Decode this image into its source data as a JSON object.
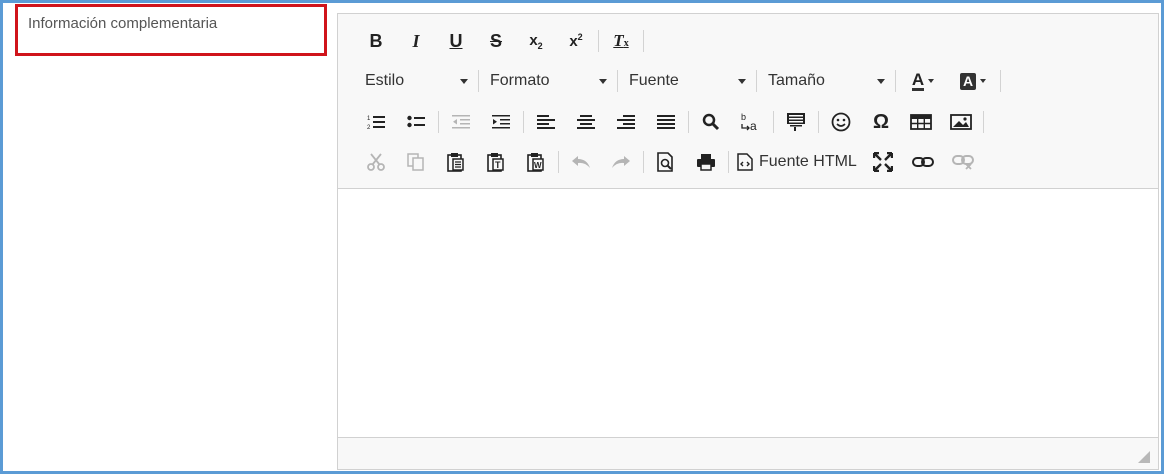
{
  "field": {
    "label": "Información complementaria"
  },
  "toolbar": {
    "row1": [
      {
        "name": "bold-button",
        "glyph": "B",
        "cls": "bold-b"
      },
      {
        "name": "italic-button",
        "glyph": "I",
        "cls": "ital-i"
      },
      {
        "name": "underline-button",
        "glyph": "U",
        "cls": "und-u"
      },
      {
        "name": "strikethrough-button",
        "glyph": "S",
        "cls": "strike-s"
      }
    ],
    "combos": {
      "style": "Estilo",
      "format": "Formato",
      "font": "Fuente",
      "size": "Tamaño"
    },
    "source_html_label": "Fuente HTML"
  },
  "colors": {
    "frame_border": "#5b9bd5",
    "label_highlight": "#d0141b",
    "toolbar_bg": "#f8f8f8"
  }
}
